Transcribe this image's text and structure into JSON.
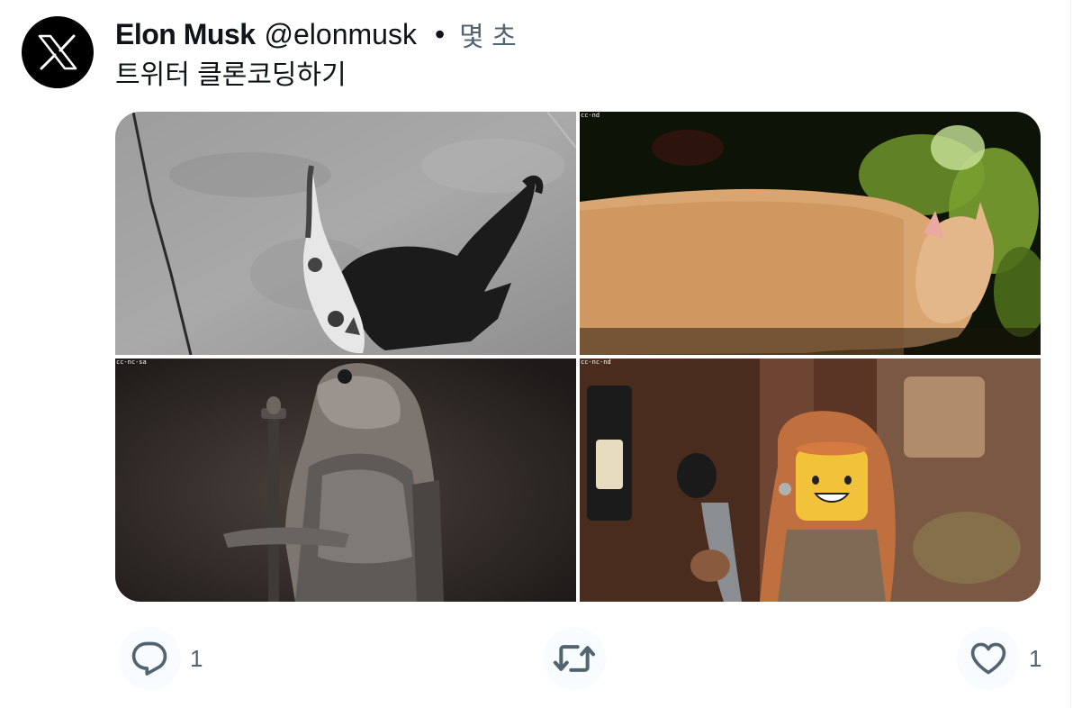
{
  "author": {
    "name": "Elon Musk",
    "handle": "@elonmusk",
    "avatar_icon": "x-logo-icon"
  },
  "separator": "•",
  "timestamp": "몇 초",
  "text": "트위터 클론코딩하기",
  "media": [
    {
      "description": "cat-shadow-photo",
      "license": ""
    },
    {
      "description": "orange-kitten-photo",
      "license": "cc-nd"
    },
    {
      "description": "knight-kitten-photo",
      "license": "cc-nc-sa"
    },
    {
      "description": "lego-minifigure-photo",
      "license": "cc-nc-nd"
    }
  ],
  "actions": {
    "reply": {
      "icon": "reply-icon",
      "count": "1"
    },
    "retweet": {
      "icon": "retweet-icon",
      "count": ""
    },
    "like": {
      "icon": "heart-icon",
      "count": "1"
    }
  },
  "colors": {
    "text_primary": "#0f1419",
    "text_secondary": "#536471",
    "icon": "#536471"
  }
}
